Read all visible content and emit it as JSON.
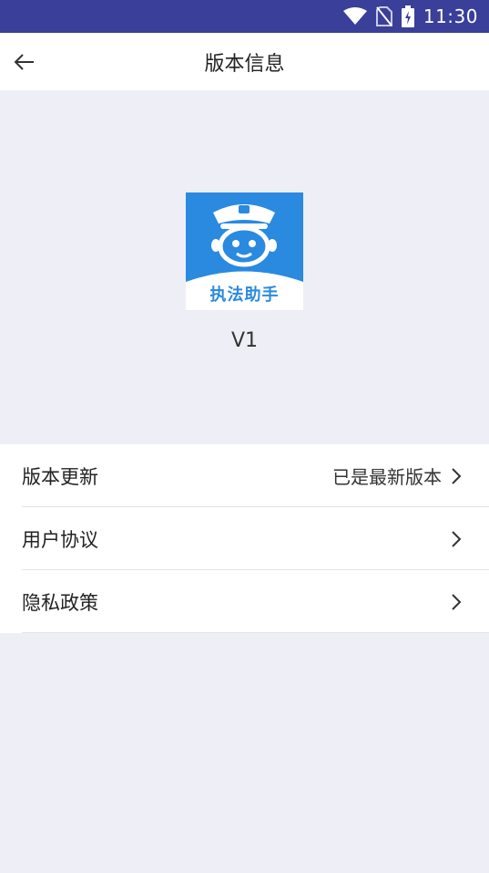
{
  "status_bar": {
    "time": "11:30",
    "icons": [
      "wifi-icon",
      "no-sim-icon",
      "battery-charging-icon"
    ]
  },
  "app_bar": {
    "back_icon": "arrow-left-icon",
    "title": "版本信息"
  },
  "hero": {
    "logo_text": "执法助手",
    "version": "V1"
  },
  "menu": {
    "items": [
      {
        "label": "版本更新",
        "value": "已是最新版本",
        "icon": "chevron-right-icon"
      },
      {
        "label": "用户协议",
        "value": "",
        "icon": "chevron-right-icon"
      },
      {
        "label": "隐私政策",
        "value": "",
        "icon": "chevron-right-icon"
      }
    ]
  },
  "colors": {
    "status_bar": "#3a3f99",
    "background": "#edeef6",
    "logo_blue": "#2a8ae0"
  }
}
